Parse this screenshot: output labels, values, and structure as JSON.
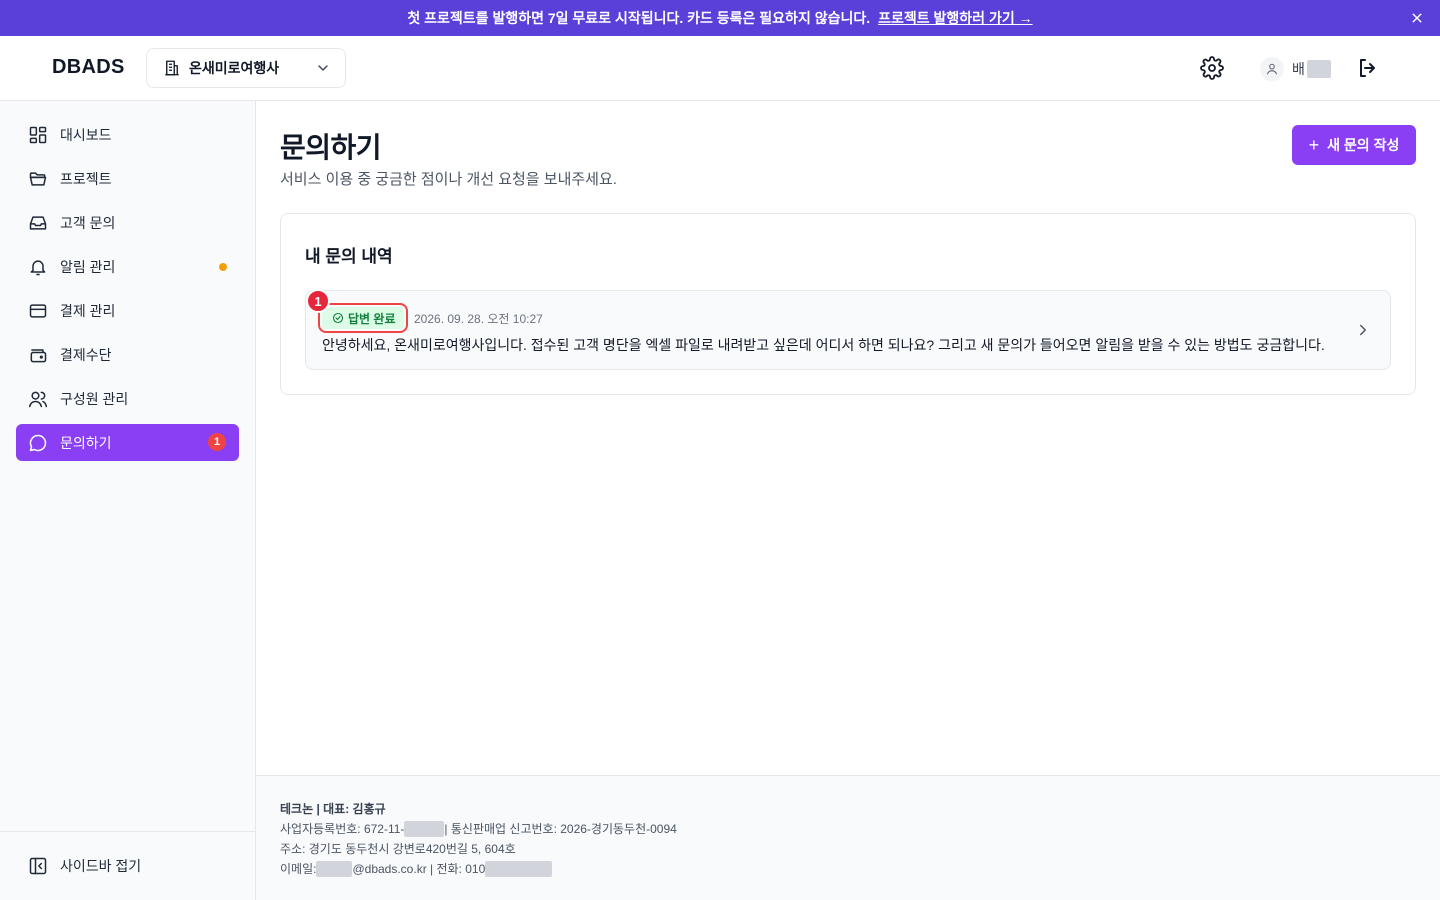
{
  "banner": {
    "text": "첫 프로젝트를 발행하면 7일 무료로 시작됩니다. 카드 등록은 필요하지 않습니다.",
    "link": "프로젝트 발행하러 가기 →",
    "close_icon": "close-icon"
  },
  "header": {
    "logo": "DBADS",
    "org": "온새미로여행사",
    "user_name": "배"
  },
  "sidebar": {
    "items": [
      {
        "label": "대시보드",
        "icon": "dashboard-icon"
      },
      {
        "label": "프로젝트",
        "icon": "folder-icon"
      },
      {
        "label": "고객 문의",
        "icon": "inbox-icon"
      },
      {
        "label": "알림 관리",
        "icon": "bell-icon"
      },
      {
        "label": "결제 관리",
        "icon": "credit-card-icon"
      },
      {
        "label": "결제수단",
        "icon": "wallet-icon"
      },
      {
        "label": "구성원 관리",
        "icon": "users-icon"
      },
      {
        "label": "문의하기",
        "icon": "chat-icon",
        "badge": "1"
      }
    ],
    "collapse_label": "사이드바 접기"
  },
  "main": {
    "title": "문의하기",
    "subtitle": "서비스 이용 중 궁금한 점이나 개선 요청을 보내주세요.",
    "new_button": "새 문의 작성",
    "card_title": "내 문의 내역",
    "inquiries": [
      {
        "status": "답변 완료",
        "marker": "1",
        "date": "2026. 09. 28. 오전 10:27",
        "text": "안녕하세요, 온새미로여행사입니다. 접수된 고객 명단을 엑셀 파일로 내려받고 싶은데 어디서 하면 되나요? 그리고 새 문의가 들어오면 알림을 받을 수 있는 방법도 궁금합니다."
      }
    ]
  },
  "footer": {
    "company": "테크논 | 대표: 김홍규",
    "biz_prefix": "사업자등록번호: 672-11-",
    "biz_suffix": " | 통신판매업 신고번호: 2026-경기동두천-0094",
    "address": "주소: 경기도 동두천시 강변로420번길 5, 604호",
    "email_prefix": "이메일: ",
    "email_suffix": "@dbads.co.kr | 전화: 010"
  },
  "colors": {
    "banner": "#5b3fd9",
    "accent": "#8b3ff5",
    "badge_red": "#ef4444",
    "dot_orange": "#f59e0b",
    "status_green_bg": "#dcfce7",
    "status_green_text": "#15803d"
  }
}
